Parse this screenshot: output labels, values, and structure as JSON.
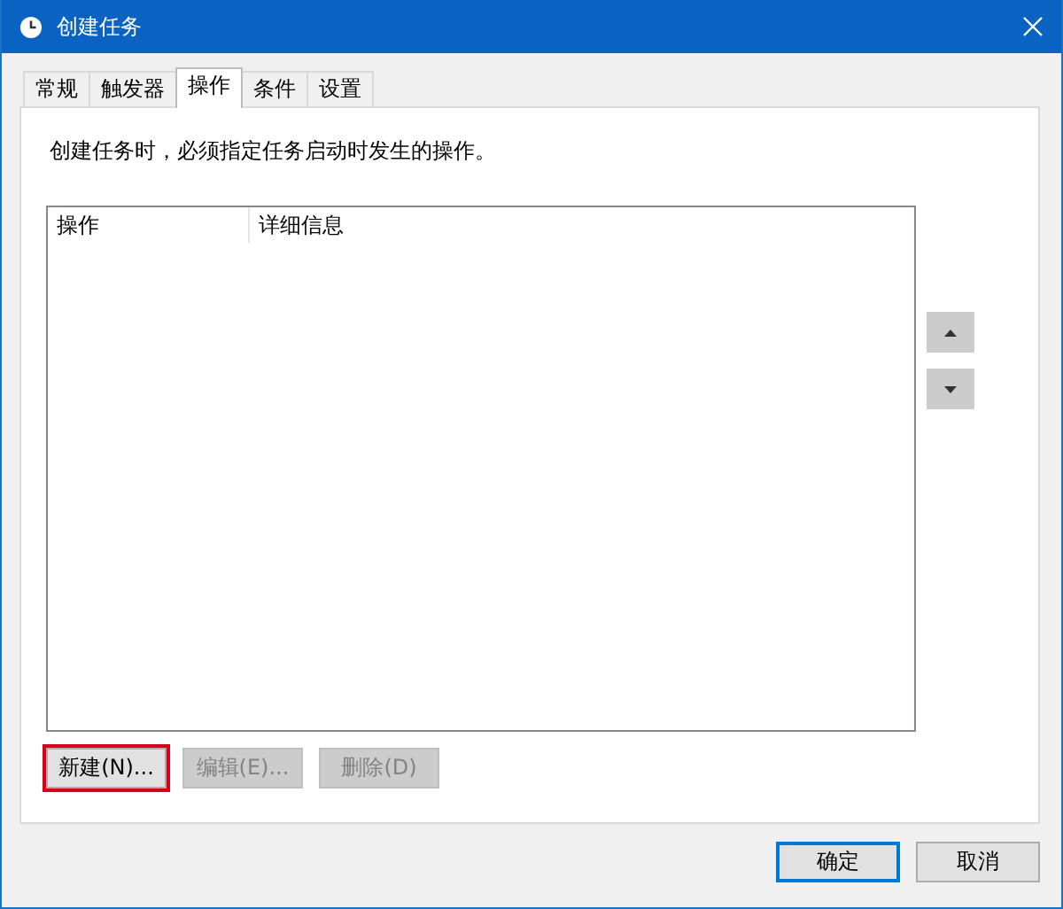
{
  "window": {
    "title": "创建任务"
  },
  "tabs": [
    {
      "label": "常规",
      "selected": false
    },
    {
      "label": "触发器",
      "selected": false
    },
    {
      "label": "操作",
      "selected": true
    },
    {
      "label": "条件",
      "selected": false
    },
    {
      "label": "设置",
      "selected": false
    }
  ],
  "description": "创建任务时，必须指定任务启动时发生的操作。",
  "table": {
    "columns": [
      "操作",
      "详细信息"
    ]
  },
  "action_buttons": [
    {
      "label": "新建(N)...",
      "disabled": false,
      "highlighted": true
    },
    {
      "label": "编辑(E)...",
      "disabled": true,
      "highlighted": false
    },
    {
      "label": "删除(D)",
      "disabled": true,
      "highlighted": false
    }
  ],
  "dialog_buttons": [
    {
      "label": "确定",
      "default": true
    },
    {
      "label": "取消",
      "default": false
    }
  ]
}
